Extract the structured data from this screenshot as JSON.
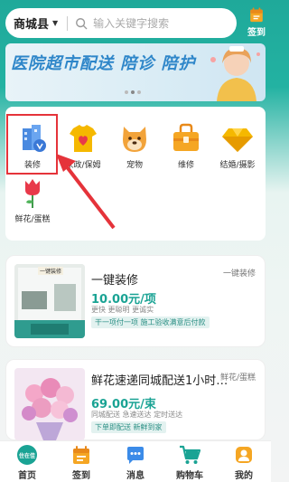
{
  "header": {
    "location": "商城县",
    "search_placeholder": "输入关键字搜索",
    "signin_label": "签到"
  },
  "banner": {
    "text": "医院超市配送 陪诊 陪护",
    "slide_count": 3,
    "active_slide": 2
  },
  "categories": [
    {
      "label": "装修",
      "icon": "building-icon"
    },
    {
      "label": "家政/保姆",
      "icon": "tshirt-heart-icon"
    },
    {
      "label": "宠物",
      "icon": "dog-icon"
    },
    {
      "label": "维修",
      "icon": "toolbox-icon"
    },
    {
      "label": "结婚/摄影",
      "icon": "diamond-icon"
    },
    {
      "label": "鲜花/蛋糕",
      "icon": "rose-icon"
    }
  ],
  "products": [
    {
      "title": "一键装修",
      "tag": "一键装修",
      "price": "10.00元/项",
      "subtitle": "更快 更聪明 更诚实",
      "badge": "干一项付一项 施工验收满意后付款",
      "image_caption": "一键装修"
    },
    {
      "title": "鲜花速递同城配送1小时…",
      "tag": "鲜花/蛋糕",
      "price": "69.00元/束",
      "subtitle": "同城配送 急速送达 定时送达",
      "badge": "下单即配送 新鲜到家"
    }
  ],
  "bottom_nav": [
    {
      "label": "首页",
      "icon": "home-icon",
      "badge_text": "住在佳"
    },
    {
      "label": "签到",
      "icon": "calendar-icon"
    },
    {
      "label": "消息",
      "icon": "message-icon"
    },
    {
      "label": "购物车",
      "icon": "cart-icon"
    },
    {
      "label": "我的",
      "icon": "user-icon"
    }
  ],
  "colors": {
    "accent": "#1aa394",
    "highlight": "#e5333a"
  }
}
